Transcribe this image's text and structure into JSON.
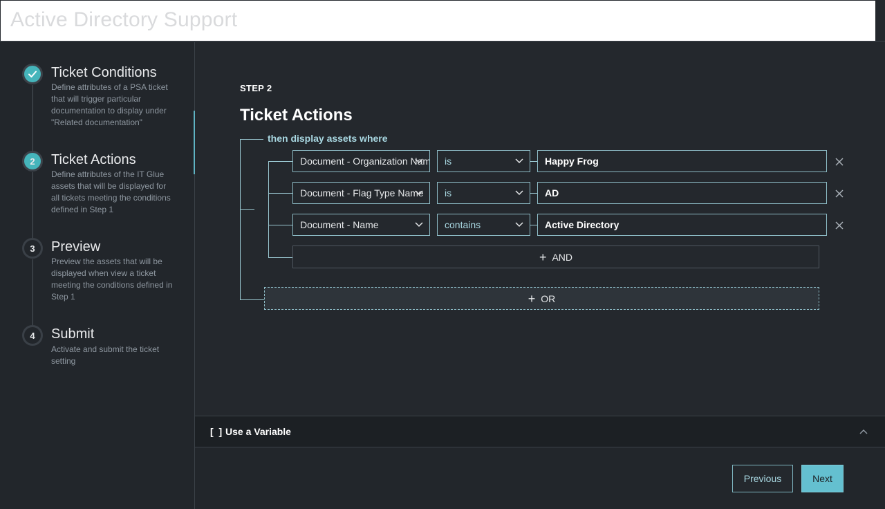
{
  "window": {
    "title": "Active Directory Support"
  },
  "sidebar": {
    "steps": [
      {
        "marker": "",
        "icon": "check-icon",
        "title": "Ticket Conditions",
        "description": "Define attributes of a PSA ticket that will trigger particular documentation to display under \"Related documentation\"",
        "state": "complete"
      },
      {
        "marker": "2",
        "title": "Ticket Actions",
        "description": "Define attributes of the IT Glue assets that will be displayed for all tickets meeting the conditions defined in Step 1",
        "state": "active"
      },
      {
        "marker": "3",
        "title": "Preview",
        "description": "Preview the assets that will be displayed when view a ticket meeting the conditions defined in Step 1",
        "state": "pending"
      },
      {
        "marker": "4",
        "title": "Submit",
        "description": "Activate and submit the ticket setting",
        "state": "pending"
      }
    ]
  },
  "main": {
    "step_label": "STEP 2",
    "title": "Ticket Actions",
    "group_label": "then display assets where",
    "conditions": [
      {
        "attribute": "Document - Organization Name",
        "operator": "is",
        "value": "Happy Frog"
      },
      {
        "attribute": "Document - Flag Type Name",
        "operator": "is",
        "value": "AD"
      },
      {
        "attribute": "Document - Name",
        "operator": "contains",
        "value": "Active Directory"
      }
    ],
    "and_label": "AND",
    "or_label": "OR"
  },
  "variable_bar": {
    "icon": "[ ]",
    "label": "Use a Variable"
  },
  "footer": {
    "previous_label": "Previous",
    "next_label": "Next"
  },
  "colors": {
    "accent": "#45b5bb",
    "link": "#a9d8e2",
    "next_button": "#64c0d0"
  }
}
